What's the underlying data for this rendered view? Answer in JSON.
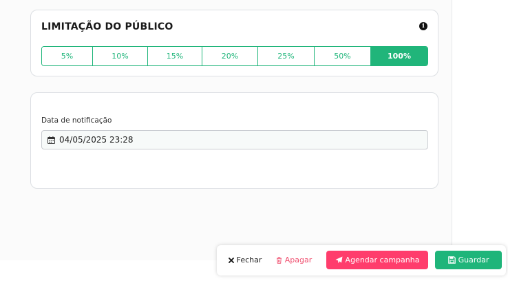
{
  "audience_card": {
    "title": "LIMITAÇÃO DO PÚBLICO",
    "info_icon": "info-circle-icon",
    "options": [
      "5%",
      "10%",
      "15%",
      "20%",
      "25%",
      "50%",
      "100%"
    ],
    "selected": "100%"
  },
  "notification_card": {
    "label": "Data de notificação",
    "value": "04/05/2025 23:28",
    "icon": "calendar-icon"
  },
  "actions": {
    "close": "Fechar",
    "delete": "Apagar",
    "schedule": "Agendar campanha",
    "save": "Guardar"
  },
  "colors": {
    "accent_green": "#1fb57a",
    "accent_pink": "#ff3d6c"
  }
}
